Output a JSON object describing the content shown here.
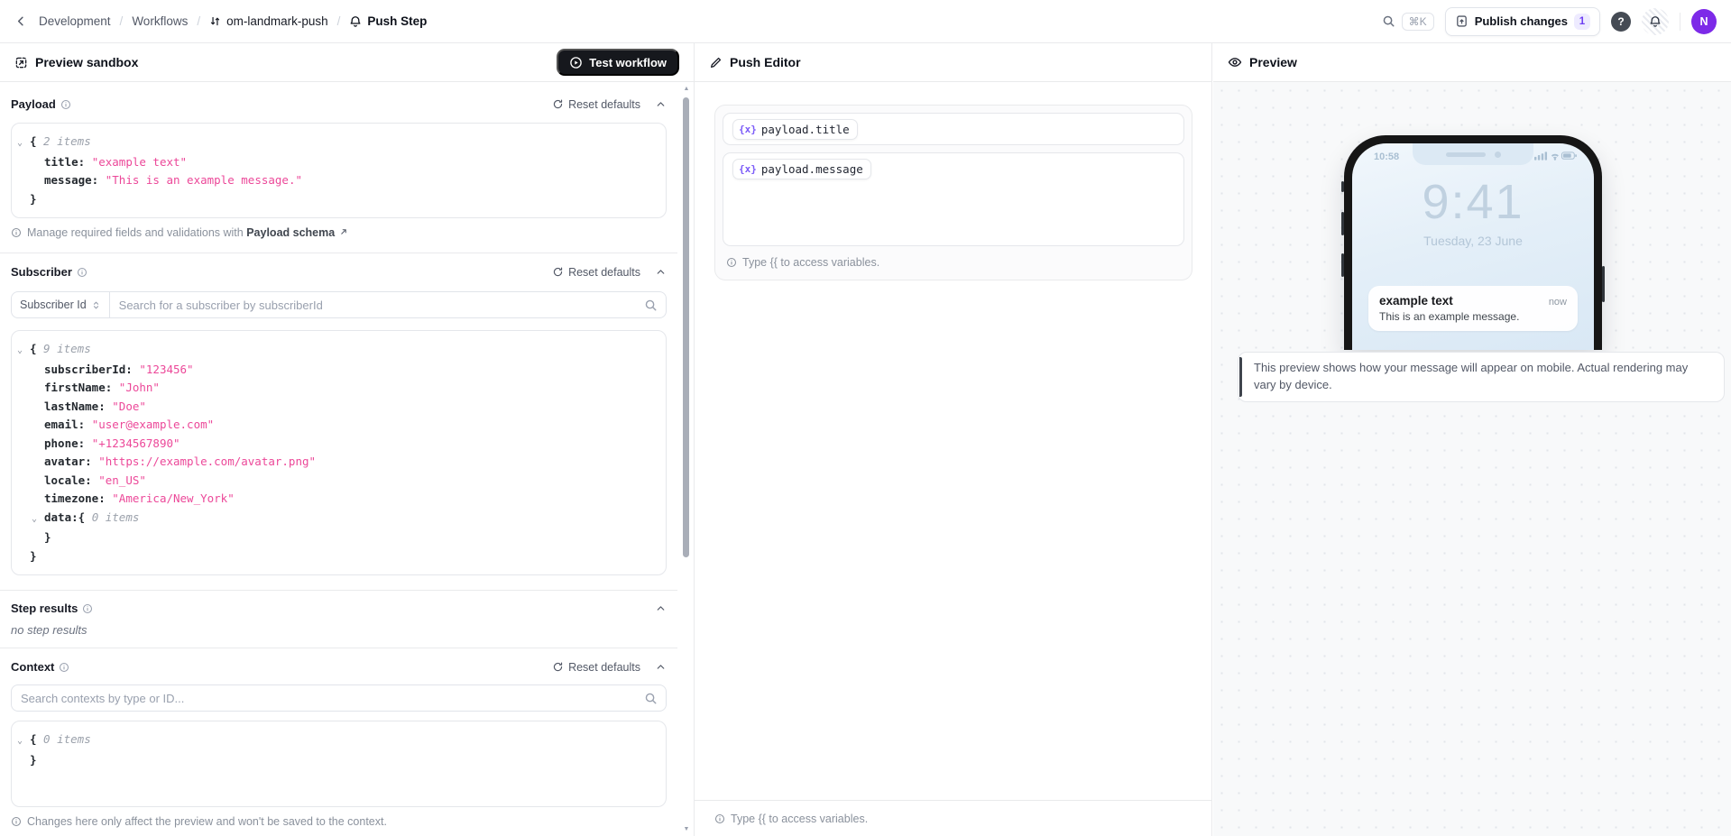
{
  "topbar": {
    "breadcrumbs": [
      {
        "label": "Development"
      },
      {
        "label": "Workflows"
      },
      {
        "label": "om-landmark-push"
      },
      {
        "label": "Push Step"
      }
    ],
    "search_shortcut": "⌘K",
    "publish_button": {
      "label": "Publish changes",
      "badge": "1"
    },
    "help_label": "?",
    "avatar_initial": "N"
  },
  "left_panel": {
    "title": "Preview sandbox",
    "test_workflow_label": "Test workflow",
    "payload": {
      "label": "Payload",
      "reset_label": "Reset defaults",
      "json": [
        {
          "indent": 0,
          "chevron": true,
          "open": "{",
          "count": "2 items"
        },
        {
          "indent": 1,
          "key": "title",
          "value": "\"example text\""
        },
        {
          "indent": 1,
          "key": "message",
          "value": "\"This is an example message.\""
        },
        {
          "indent": 0,
          "close": "}"
        }
      ],
      "schema_hint_prefix": "Manage required fields and validations with",
      "schema_link": "Payload schema"
    },
    "subscriber": {
      "label": "Subscriber",
      "reset_label": "Reset defaults",
      "filter_label": "Subscriber Id",
      "search_placeholder": "Search for a subscriber by subscriberId",
      "json": [
        {
          "indent": 0,
          "chevron": true,
          "open": "{",
          "count": "9 items"
        },
        {
          "indent": 1,
          "key": "subscriberId",
          "value": "\"123456\""
        },
        {
          "indent": 1,
          "key": "firstName",
          "value": "\"John\""
        },
        {
          "indent": 1,
          "key": "lastName",
          "value": "\"Doe\""
        },
        {
          "indent": 1,
          "key": "email",
          "value": "\"user@example.com\""
        },
        {
          "indent": 1,
          "key": "phone",
          "value": "\"+1234567890\""
        },
        {
          "indent": 1,
          "key": "avatar",
          "value": "\"https://example.com/avatar.png\""
        },
        {
          "indent": 1,
          "key": "locale",
          "value": "\"en_US\""
        },
        {
          "indent": 1,
          "key": "timezone",
          "value": "\"America/New_York\""
        },
        {
          "indent": 1,
          "chevron": true,
          "key": "data",
          "open": "{",
          "count": "0 items"
        },
        {
          "indent": 1,
          "close": "}"
        },
        {
          "indent": 0,
          "close": "}"
        }
      ]
    },
    "step_results": {
      "label": "Step results",
      "empty": "no step results"
    },
    "context": {
      "label": "Context",
      "reset_label": "Reset defaults",
      "search_placeholder": "Search contexts by type or ID...",
      "json": [
        {
          "indent": 0,
          "chevron": true,
          "open": "{",
          "count": "0 items"
        },
        {
          "indent": 0,
          "close": "}"
        }
      ],
      "hint": "Changes here only affect the preview and won't be saved to the context."
    }
  },
  "editor_panel": {
    "title": "Push Editor",
    "title_field_variable": "payload.title",
    "message_field_variable": "payload.message",
    "variable_icon": "{x}",
    "variables_hint": "Type {{ to access variables.",
    "footer_hint": "Type {{ to access variables."
  },
  "preview_panel": {
    "title": "Preview",
    "phone": {
      "status_time": "10:58",
      "clock": "9:41",
      "date": "Tuesday, 23 June",
      "notification_title": "example text",
      "notification_time": "now",
      "notification_body": "This is an example message."
    },
    "note": "This preview shows how your message will appear on mobile. Actual rendering may vary by device."
  },
  "colors": {
    "accent_purple": "#7d2ae8",
    "variable_purple": "#7a5af8",
    "json_string_pink": "#ec4899",
    "dark_button": "#16181d",
    "border": "#e9eaec"
  }
}
